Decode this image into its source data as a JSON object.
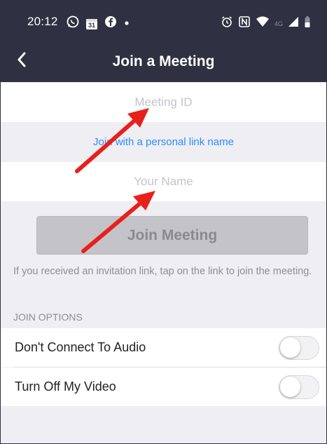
{
  "status_bar": {
    "time": "20:12",
    "icons_left": [
      "whatsapp-icon",
      "calendar-icon",
      "facebook-icon",
      "dot-icon"
    ],
    "calendar_number": "31",
    "network_label": "4G",
    "icons_right": [
      "alarm-icon",
      "nfc-icon",
      "wifi-icon",
      "signal-icon",
      "battery-icon"
    ]
  },
  "header": {
    "title": "Join a Meeting",
    "back_icon": "chevron-left-icon"
  },
  "form": {
    "meeting_id": {
      "placeholder": "Meeting ID",
      "value": ""
    },
    "personal_link_label": "Join with a personal link name",
    "your_name": {
      "placeholder": "Your Name",
      "value": ""
    },
    "join_button_label": "Join Meeting",
    "join_button_enabled": false,
    "hint": "If you received an invitation link, tap on the link to join the meeting."
  },
  "join_options": {
    "header": "JOIN OPTIONS",
    "items": [
      {
        "label": "Don't Connect To Audio",
        "enabled": false
      },
      {
        "label": "Turn Off My Video",
        "enabled": false
      }
    ]
  },
  "annotations": {
    "arrow_color": "#e8201c"
  },
  "colors": {
    "header_bg": "#2f3142",
    "link": "#2d8cff",
    "page_bg": "#eeeef3",
    "button_disabled_bg": "#c4c4c8"
  }
}
